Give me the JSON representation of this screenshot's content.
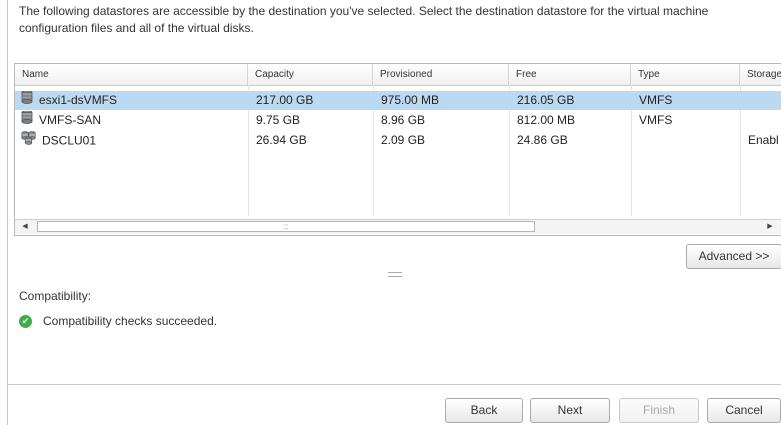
{
  "instructions": "The following datastores are accessible by the destination you've selected. Select the destination datastore for the virtual machine configuration files and all of the virtual disks.",
  "grid": {
    "columns": [
      "Name",
      "Capacity",
      "Provisioned",
      "Free",
      "Type",
      "Storage"
    ],
    "rows": [
      {
        "name": "esxi1-dsVMFS",
        "icon": "datastore-icon",
        "capacity": "217.00 GB",
        "provisioned": "975.00 MB",
        "free": "216.05 GB",
        "type": "VMFS",
        "storage": "",
        "selected": true
      },
      {
        "name": "VMFS-SAN",
        "icon": "datastore-icon",
        "capacity": "9.75 GB",
        "provisioned": "8.96 GB",
        "free": "812.00 MB",
        "type": "VMFS",
        "storage": "",
        "selected": false
      },
      {
        "name": "DSCLU01",
        "icon": "datastore-cluster-icon",
        "capacity": "26.94 GB",
        "provisioned": "2.09 GB",
        "free": "24.86 GB",
        "type": "",
        "storage": "Enabl",
        "selected": false
      }
    ],
    "scroll_grip": "::"
  },
  "advanced_button": "Advanced >>",
  "compatibility": {
    "label": "Compatibility:",
    "status": "Compatibility checks succeeded.",
    "status_color": "#3fae49"
  },
  "footer": {
    "back": "Back",
    "next": "Next",
    "finish": "Finish",
    "cancel": "Cancel"
  },
  "selection_color": "#bcd9f2"
}
